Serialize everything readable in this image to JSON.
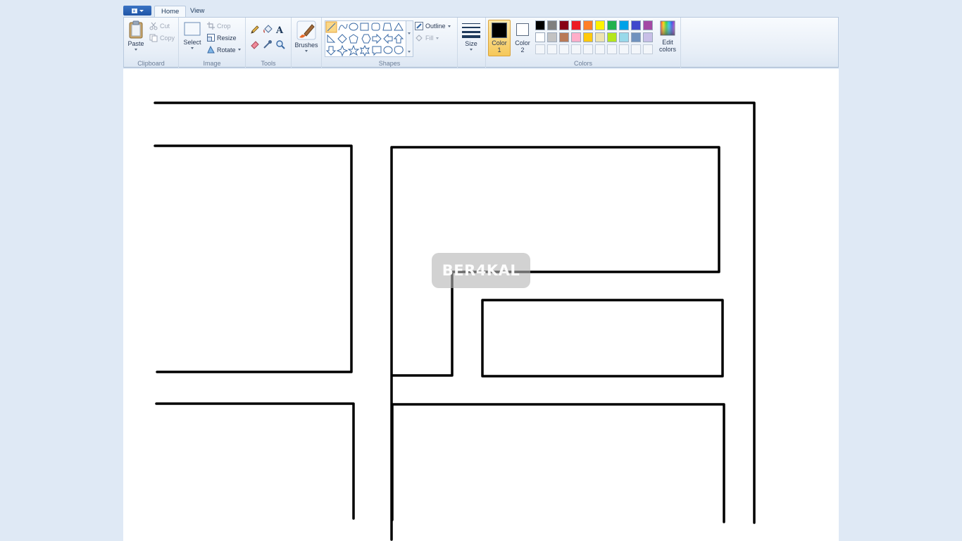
{
  "tabs": {
    "home": "Home",
    "view": "View"
  },
  "clipboard": {
    "paste": "Paste",
    "cut": "Cut",
    "copy": "Copy",
    "label": "Clipboard"
  },
  "image": {
    "select": "Select",
    "crop": "Crop",
    "resize": "Resize",
    "rotate": "Rotate",
    "label": "Image"
  },
  "tools": {
    "label": "Tools"
  },
  "brushes": {
    "label": "Brushes"
  },
  "shapes": {
    "outline": "Outline",
    "fill": "Fill",
    "label": "Shapes"
  },
  "size": {
    "label": "Size"
  },
  "colors": {
    "color1_line1": "Color",
    "color1_line2": "1",
    "color2_line1": "Color",
    "color2_line2": "2",
    "edit_line1": "Edit",
    "edit_line2": "colors",
    "label": "Colors",
    "color1": "#000000",
    "color2": "#ffffff",
    "palette_row1": [
      "#000000",
      "#7f7f7f",
      "#880015",
      "#ed1c24",
      "#ff7f27",
      "#fff200",
      "#22b14c",
      "#00a2e8",
      "#3f48cc",
      "#a349a4"
    ],
    "palette_row2": [
      "#ffffff",
      "#c3c3c3",
      "#b97a57",
      "#ffaec9",
      "#ffc90e",
      "#efe4b0",
      "#b5e61d",
      "#99d9ea",
      "#7092be",
      "#c8bfe7"
    ]
  },
  "watermark": "BER4KAL"
}
